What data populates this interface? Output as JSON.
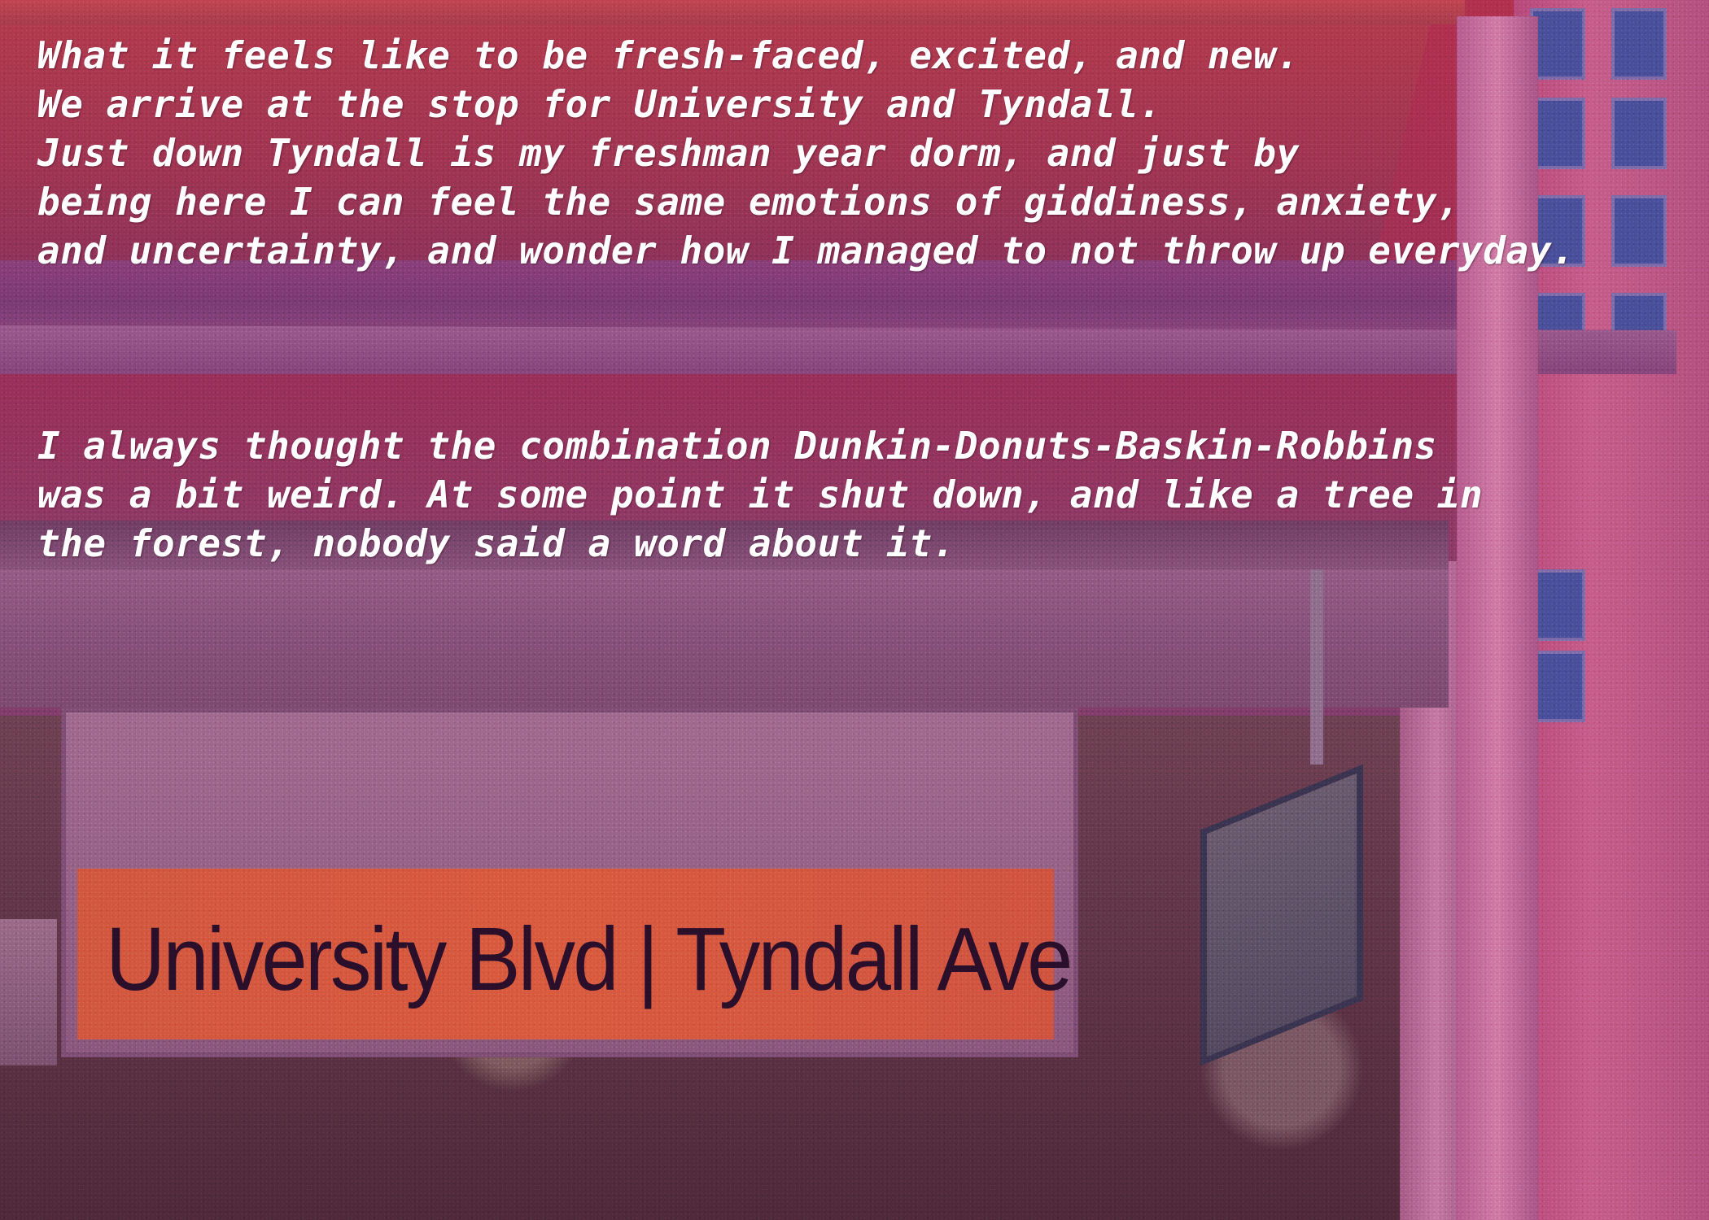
{
  "caption_1": {
    "lines": [
      "What it feels like to be fresh-faced, excited, and new.",
      "We arrive at the stop for University and Tyndall.",
      "Just down Tyndall is my freshman year dorm, and just by",
      "being here I can feel the same emotions of giddiness, anxiety,",
      "and uncertainty, and wonder how I managed to not throw up everyday."
    ]
  },
  "caption_2": {
    "lines": [
      "I always thought the combination Dunkin-Donuts-Baskin-Robbins",
      "was a bit weird. At some point it shut down, and like a tree in",
      "the forest, nobody said a word about it."
    ]
  },
  "station_sign": {
    "text": "University Blvd | Tyndall Ave"
  },
  "colors": {
    "tint": "#9a2f58",
    "sign_bar": "#d85a3f",
    "caption_text": "#ffffff"
  }
}
